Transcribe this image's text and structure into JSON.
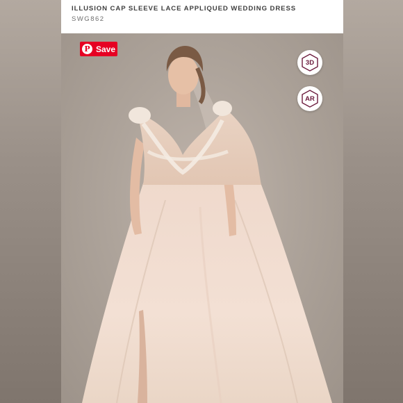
{
  "product": {
    "title": "ILLUSION CAP SLEEVE LACE APPLIQUED WEDDING DRESS",
    "sku": "SWG862"
  },
  "save_button": {
    "label": "Save",
    "icon": "pinterest-icon"
  },
  "view_buttons": [
    {
      "label": "3D",
      "icon": "hexagon-icon"
    },
    {
      "label": "AR",
      "icon": "hexagon-icon"
    }
  ],
  "colors": {
    "pinterest": "#e60023",
    "badge_accent": "#6b1a3c",
    "backdrop": "#aea49b"
  }
}
